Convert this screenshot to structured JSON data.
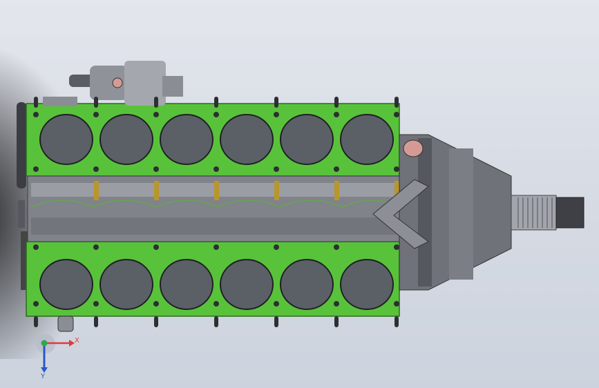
{
  "viewport": {
    "background_top": "#e3e6ec",
    "background_bottom": "#cdd3de"
  },
  "model": {
    "block_color": "#59c23b",
    "cylinder_color": "#5b5f66",
    "metal_color": "#8a8d93",
    "bolt_color": "#2d2f33",
    "gold_accent": "#b9962b",
    "pink_accent": "#d59a94",
    "cylinders_per_bank": 6,
    "banks": 2
  },
  "triad": {
    "x_label": "X",
    "y_label": "Y",
    "x_color": "#e23b3b",
    "y_color": "#2a57c9",
    "origin_color": "#2fa84f"
  }
}
